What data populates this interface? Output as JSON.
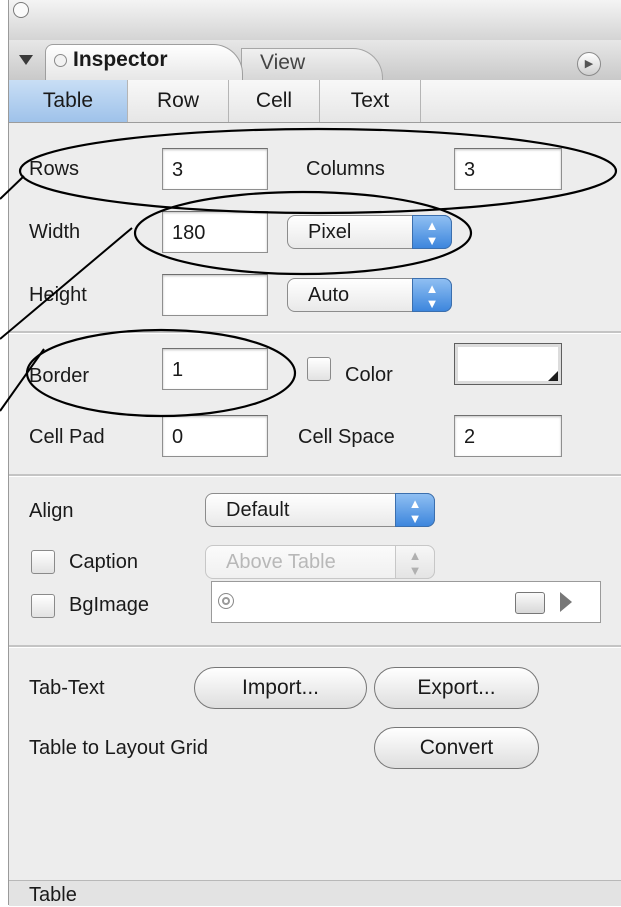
{
  "palette": {
    "window_bg": "#ededed",
    "active_tab": "#b3d0f0",
    "stepper_blue": "#3d86dd",
    "annotation_stroke": "#000000"
  },
  "icons": {
    "window_circle": "circle-icon",
    "collapse": "disclosure-triangle-icon",
    "tab_gadget": "arrow-circle-icon",
    "stepper": "up-down-arrows-icon",
    "bgimage_target": "target-icon",
    "folder": "folder-icon",
    "play": "play-icon"
  },
  "window": {
    "tabs": [
      {
        "label": "Inspector",
        "active": true
      },
      {
        "label": "View",
        "active": false
      }
    ]
  },
  "subtabs": [
    {
      "label": "Table",
      "active": true
    },
    {
      "label": "Row",
      "active": false
    },
    {
      "label": "Cell",
      "active": false
    },
    {
      "label": "Text",
      "active": false
    }
  ],
  "table_section": {
    "rows_label": "Rows",
    "rows_value": "3",
    "columns_label": "Columns",
    "columns_value": "3",
    "width_label": "Width",
    "width_value": "180",
    "width_unit": "Pixel",
    "height_label": "Height",
    "height_value": "",
    "height_unit": "Auto"
  },
  "border_section": {
    "border_label": "Border",
    "border_value": "1",
    "color_label": "Color",
    "cellpad_label": "Cell Pad",
    "cellpad_value": "0",
    "cellspace_label": "Cell Space",
    "cellspace_value": "2"
  },
  "align_section": {
    "align_label": "Align",
    "align_value": "Default",
    "caption_label": "Caption",
    "caption_value": "Above Table",
    "bgimage_label": "BgImage",
    "bgimage_path": ""
  },
  "actions_section": {
    "tabtext_label": "Tab-Text",
    "import_label": "Import...",
    "export_label": "Export...",
    "layout_grid_label": "Table to Layout Grid",
    "convert_label": "Convert"
  },
  "status": {
    "text": "Table"
  }
}
